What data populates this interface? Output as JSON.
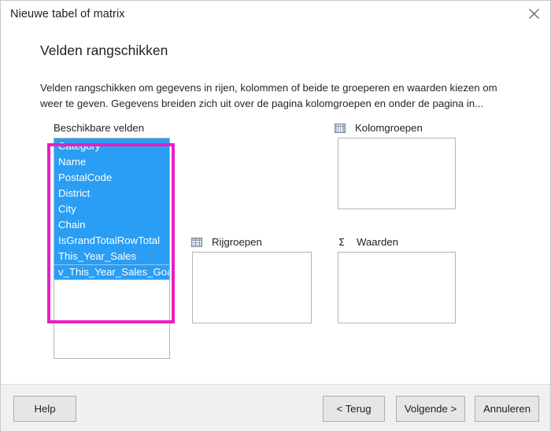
{
  "titlebar": {
    "title": "Nieuwe tabel of matrix",
    "close_icon": "close-icon"
  },
  "page": {
    "heading": "Velden rangschikken",
    "description": "Velden rangschikken om gegevens in rijen, kolommen of beide te groeperen en waarden kiezen om weer te geven. Gegevens breiden zich uit over de pagina kolomgroepen en onder de pagina in..."
  },
  "available_fields": {
    "label": "Beschikbare velden",
    "items": [
      "Category",
      "Name",
      "PostalCode",
      "District",
      "City",
      "Chain",
      "IsGrandTotalRowTotal",
      "This_Year_Sales",
      "v_This_Year_Sales_Goal"
    ],
    "selected_all": true,
    "focused_item": "v_This_Year_Sales_Goal"
  },
  "callout": {
    "color": "#e81fbe"
  },
  "panels": {
    "column_groups": {
      "title": "Kolomgroepen",
      "icon": "column-grid-icon",
      "items": []
    },
    "row_groups": {
      "title": "Rijgroepen",
      "icon": "row-grid-icon",
      "items": []
    },
    "values": {
      "title": "Waarden",
      "icon": "sigma-icon",
      "icon_glyph": "Σ",
      "items": []
    }
  },
  "footer": {
    "help": "Help",
    "back": "< Terug",
    "next": "Volgende >",
    "cancel": "Annuleren"
  },
  "colors": {
    "selection_blue": "#2a9df4",
    "callout_magenta": "#e81fbe",
    "footer_bg": "#f0f0f0",
    "button_bg": "#e6e6e6"
  }
}
